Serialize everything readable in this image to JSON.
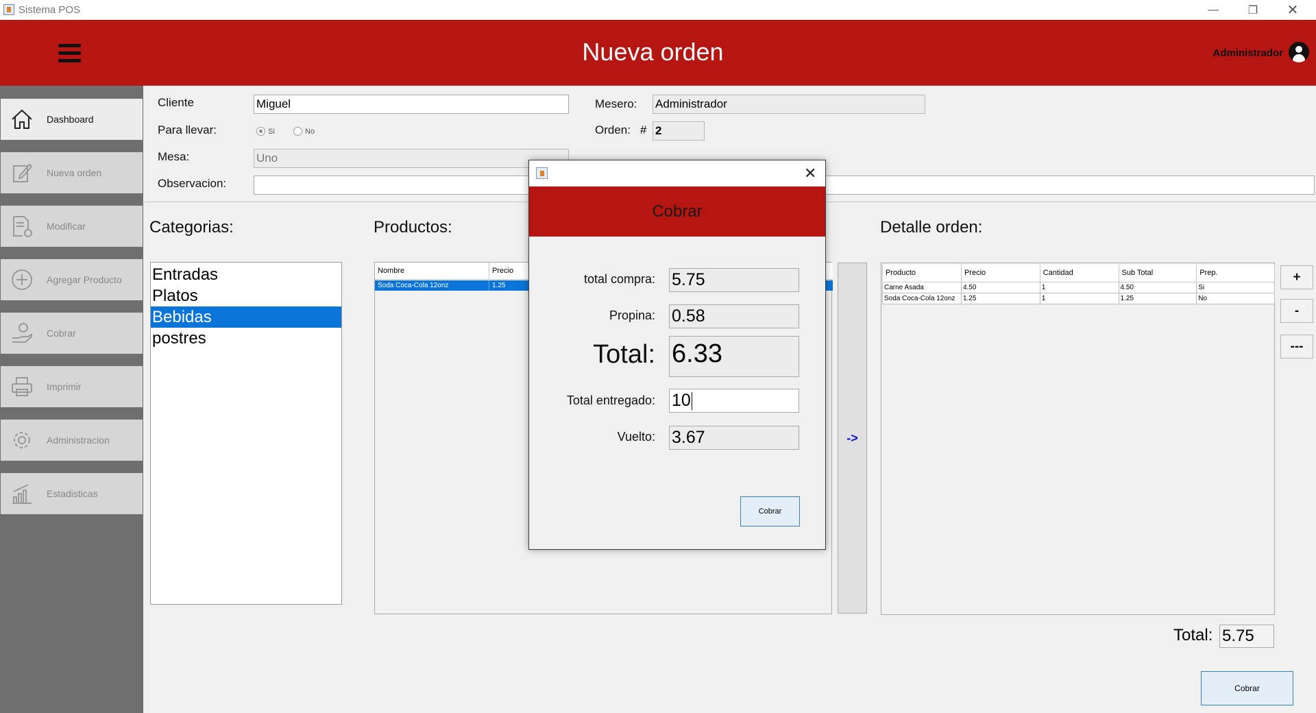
{
  "window": {
    "title": "Sistema POS",
    "minimize": "—",
    "maximize": "❐",
    "close": "✕"
  },
  "header": {
    "title": "Nueva orden",
    "user": "Administrador"
  },
  "sidebar": {
    "items": [
      {
        "label": "Dashboard",
        "icon": "home-icon"
      },
      {
        "label": "Nueva orden",
        "icon": "edit-icon"
      },
      {
        "label": "Modificar",
        "icon": "document-refresh-icon"
      },
      {
        "label": "Agregar Producto",
        "icon": "plus-circle-icon"
      },
      {
        "label": "Cobrar",
        "icon": "hand-coin-icon"
      },
      {
        "label": "Imprimir",
        "icon": "printer-icon"
      },
      {
        "label": "Administracion",
        "icon": "gear-icon"
      },
      {
        "label": "Estadisticas",
        "icon": "bar-chart-icon"
      }
    ]
  },
  "form": {
    "cliente_label": "Cliente",
    "cliente_value": "Miguel",
    "para_llevar_label": "Para llevar:",
    "si_label": "Si",
    "no_label": "No",
    "mesa_label": "Mesa:",
    "mesa_value": "Uno",
    "observacion_label": "Observacion:",
    "observacion_value": "",
    "mesero_label": "Mesero:",
    "mesero_value": "Administrador",
    "orden_label": "Orden:",
    "orden_hash": "#",
    "orden_value": "2"
  },
  "categorias": {
    "title": "Categorias:",
    "items": [
      "Entradas",
      "Platos",
      "Bebidas",
      "postres"
    ],
    "selected": "Bebidas"
  },
  "productos": {
    "title": "Productos:",
    "columns": [
      "Nombre",
      "Precio"
    ],
    "rows": [
      {
        "nombre": "Soda Coca-Cola 12onz",
        "precio": "1.25"
      }
    ]
  },
  "transfer_button": "->",
  "detalle": {
    "title": "Detalle orden:",
    "columns": [
      "Producto",
      "Precio",
      "Cantidad",
      "Sub Total",
      "Prep."
    ],
    "rows": [
      [
        "Carne Asada",
        "4.50",
        "1",
        "4.50",
        "Si"
      ],
      [
        "Soda Coca-Cola 12onz",
        "1.25",
        "1",
        "1.25",
        "No"
      ]
    ],
    "buttons": {
      "add": "+",
      "remove": "-",
      "clear": "---"
    },
    "total_label": "Total:",
    "total_value": "5.75",
    "cobrar": "Cobrar"
  },
  "dialog": {
    "title": "Cobrar",
    "close": "✕",
    "total_compra_label": "total compra:",
    "total_compra": "5.75",
    "propina_label": "Propina:",
    "propina": "0.58",
    "total_label": "Total:",
    "total": "6.33",
    "entregado_label": "Total entregado:",
    "entregado": "10",
    "vuelto_label": "Vuelto:",
    "vuelto": "3.67",
    "button": "Cobrar"
  }
}
